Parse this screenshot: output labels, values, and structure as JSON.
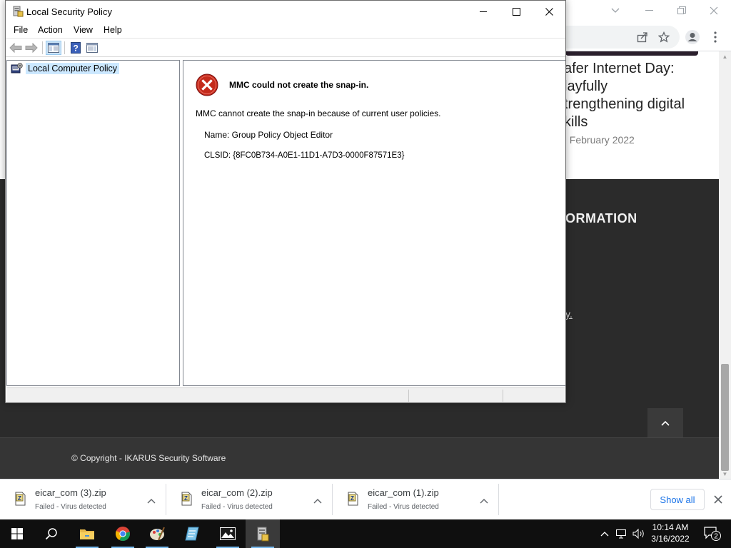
{
  "browser": {
    "article_title_lines": [
      "afer Internet Day:",
      "layfully",
      "trengthening digital",
      "kills"
    ],
    "article_date": ". February 2022",
    "footer_heading": "ORMATION",
    "footer_link": "y.",
    "copyright": "© Copyright - IKARUS Security Software",
    "controls": [
      "chevron-down-icon",
      "minimize-icon",
      "restore-icon",
      "close-icon"
    ]
  },
  "downloads": {
    "items": [
      {
        "name": "eicar_com (3).zip",
        "status": "Failed - Virus detected"
      },
      {
        "name": "eicar_com (2).zip",
        "status": "Failed - Virus detected"
      },
      {
        "name": "eicar_com (1).zip",
        "status": "Failed - Virus detected"
      }
    ],
    "show_all_label": "Show all"
  },
  "mmc": {
    "title": "Local Security Policy",
    "menu": [
      "File",
      "Action",
      "View",
      "Help"
    ],
    "tree": {
      "root_label": "Local Computer Policy"
    },
    "error": {
      "title": "MMC could not create the snap-in.",
      "message": "MMC cannot create the snap-in because of current user policies.",
      "name_line": "Name: Group Policy Object Editor",
      "clsid_line": "CLSID: {8FC0B734-A0E1-11D1-A7D3-0000F87571E3}"
    }
  },
  "taskbar": {
    "time": "10:14 AM",
    "date": "3/16/2022",
    "notification_count": "2",
    "pinned": [
      "windows-start-icon",
      "search-icon",
      "file-explorer-icon",
      "chrome-icon",
      "paint-icon",
      "notepad-icon",
      "photos-icon",
      "security-policy-icon"
    ]
  },
  "colors": {
    "footer_dark": "#2b2b2b",
    "download_link_blue": "#1a73e8",
    "error_red": "#c42b1c",
    "selection_blue": "#cce8ff",
    "taskbar_bg": "#0f0f0f"
  }
}
